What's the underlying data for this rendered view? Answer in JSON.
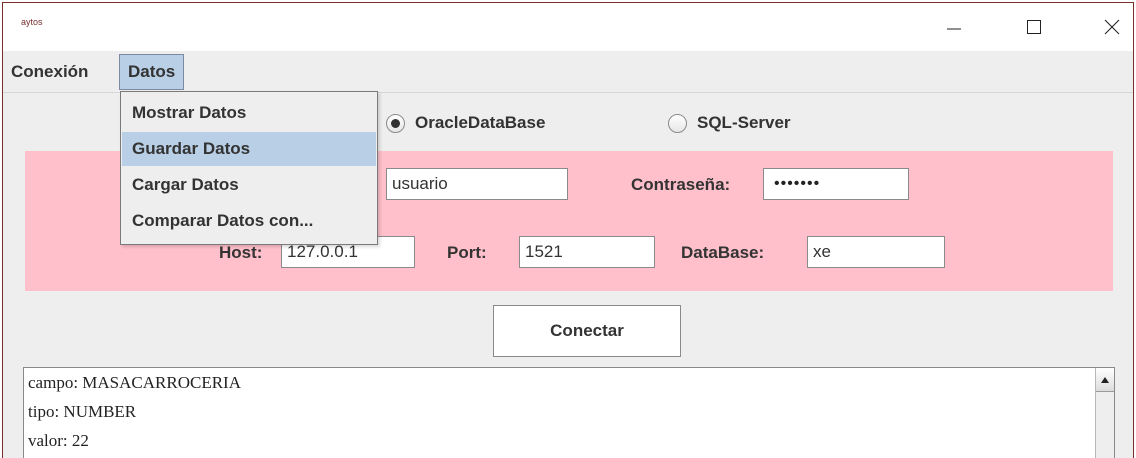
{
  "window": {
    "title": "aytos",
    "controls": {
      "minimize": "minimize-icon",
      "maximize": "maximize-icon",
      "close": "close-icon"
    }
  },
  "menubar": {
    "items": [
      {
        "label": "Conexión"
      },
      {
        "label": "Datos",
        "open": true
      }
    ]
  },
  "datos_menu": {
    "items": [
      {
        "label": "Mostrar Datos"
      },
      {
        "label": "Guardar Datos",
        "highlighted": true
      },
      {
        "label": "Cargar Datos"
      },
      {
        "label": "Comparar Datos con..."
      }
    ]
  },
  "db_type": {
    "options": [
      {
        "label": "OracleDataBase",
        "selected": true
      },
      {
        "label": "SQL-Server",
        "selected": false
      }
    ]
  },
  "connection": {
    "user_value": "usuario",
    "password_label": "Contraseña:",
    "password_mask": "•••••••",
    "host_label": "Host:",
    "host_value": "127.0.0.1",
    "port_label": "Port:",
    "port_value": "1521",
    "database_label": "DataBase:",
    "database_value": "xe"
  },
  "connect_button": {
    "label": "Conectar"
  },
  "output": {
    "lines": [
      "campo: MASACARROCERIA",
      "tipo: NUMBER",
      "valor: 22"
    ]
  },
  "colors": {
    "panel_background": "#ffc0cb",
    "window_background": "#eeeeee",
    "menu_highlight": "#b8cfe5",
    "window_border": "#7a2f2f"
  }
}
